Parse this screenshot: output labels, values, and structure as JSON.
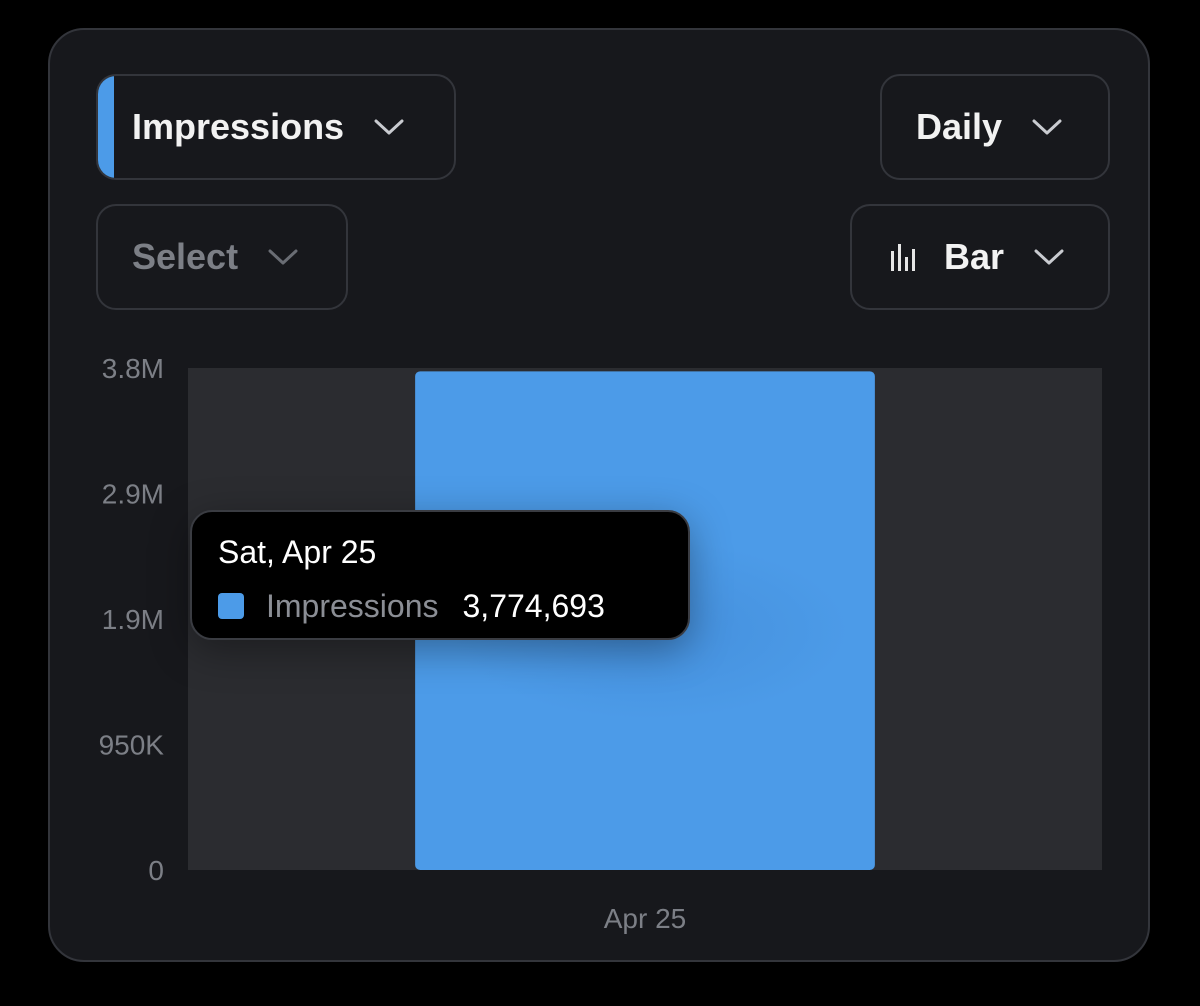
{
  "controls": {
    "metric_label": "Impressions",
    "select_placeholder": "Select",
    "period_label": "Daily",
    "chart_type_label": "Bar"
  },
  "colors": {
    "accent": "#4c9be8",
    "card_background": "#17181c",
    "plot_background": "#2b2c30",
    "muted_text": "#7c7f86"
  },
  "icons": [
    "chevron-down-icon",
    "bar-chart-icon"
  ],
  "tooltip": {
    "date": "Sat, Apr 25",
    "series_name": "Impressions",
    "value": "3,774,693"
  },
  "chart_data": {
    "type": "bar",
    "categories": [
      "Apr 25"
    ],
    "series": [
      {
        "name": "Impressions",
        "values": [
          3774693
        ]
      }
    ],
    "ylim": [
      0,
      3800000
    ],
    "yticks": [
      0,
      950000,
      1900000,
      2850000,
      3800000
    ],
    "ytick_labels": [
      "0",
      "950K",
      "1.9M",
      "2.9M",
      "3.8M"
    ],
    "xtick_labels": [
      "Apr 25"
    ],
    "grid": false
  }
}
